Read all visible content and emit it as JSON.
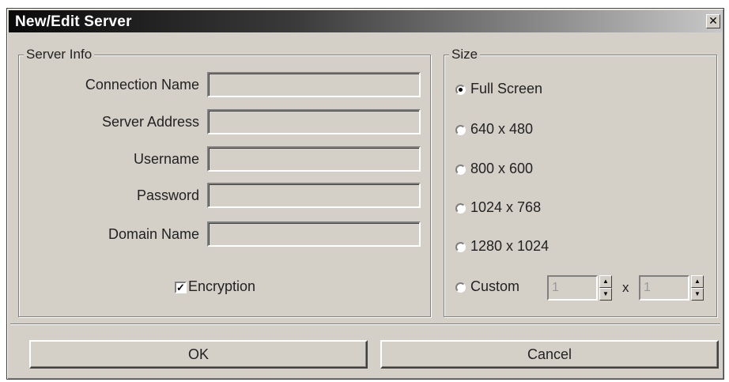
{
  "window": {
    "title": "New/Edit Server",
    "close_glyph": "✕"
  },
  "server_info": {
    "legend": "Server Info",
    "fields": [
      {
        "label": "Connection Name",
        "value": ""
      },
      {
        "label": "Server Address",
        "value": ""
      },
      {
        "label": "Username",
        "value": ""
      },
      {
        "label": "Password",
        "value": ""
      },
      {
        "label": "Domain Name",
        "value": ""
      }
    ],
    "encryption": {
      "label": "Encryption",
      "checked": true,
      "check_glyph": "✓"
    }
  },
  "size": {
    "legend": "Size",
    "options": [
      {
        "label": "Full Screen",
        "selected": true
      },
      {
        "label": "640 x 480",
        "selected": false
      },
      {
        "label": "800 x 600",
        "selected": false
      },
      {
        "label": "1024 x 768",
        "selected": false
      },
      {
        "label": "1280 x 1024",
        "selected": false
      },
      {
        "label": "Custom",
        "selected": false
      }
    ],
    "custom_width": "1",
    "custom_separator": "x",
    "custom_height": "1",
    "spin_up_glyph": "▲",
    "spin_down_glyph": "▼"
  },
  "buttons": {
    "ok": "OK",
    "cancel": "Cancel"
  },
  "colors": {
    "face": "#d4d0c8",
    "title_start": "#0a0a0a",
    "title_end": "#c8c8c8"
  }
}
